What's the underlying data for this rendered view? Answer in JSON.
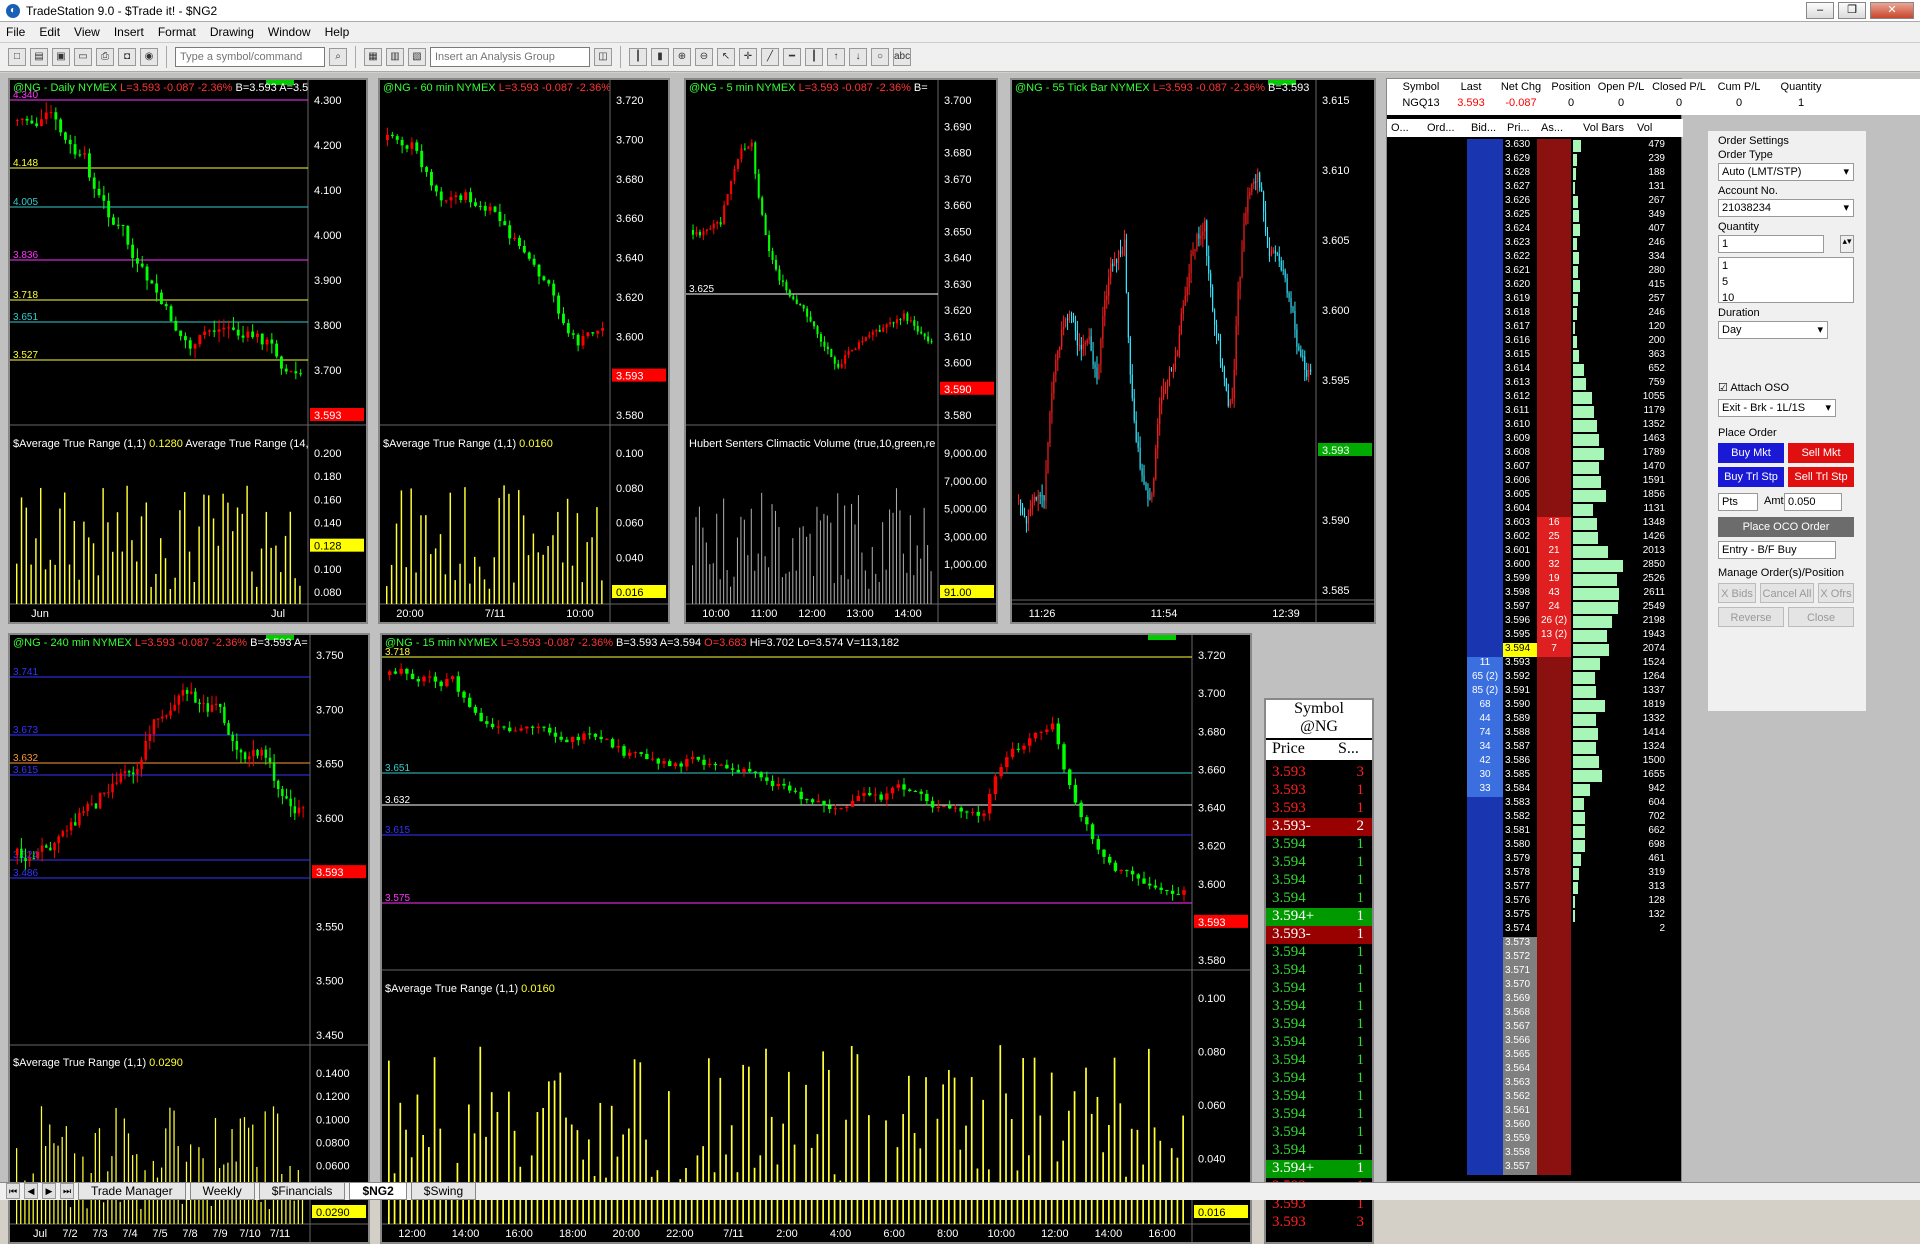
{
  "window": {
    "title": "TradeStation 9.0 - $Trade it! - $NG2"
  },
  "menu": [
    "File",
    "Edit",
    "View",
    "Insert",
    "Format",
    "Drawing",
    "Window",
    "Help"
  ],
  "toolbar": {
    "symbol_placeholder": "Type a symbol/command",
    "analysis_placeholder": "Insert an Analysis Group"
  },
  "charts": {
    "daily": {
      "symbol": "@NG - Daily",
      "exchange": "NYMEX",
      "last": "L=3.593",
      "chg": "-0.087",
      "pct": "-2.36%",
      "bid": "B=3.593",
      "ask": "A=3.5",
      "indicator": "$Average True Range (1,1)",
      "indicator_val": "0.1280",
      "indicator2": "Average True Range (14,",
      "y_ticks": [
        "4.300",
        "4.200",
        "4.100",
        "4.000",
        "3.900",
        "3.800",
        "3.700",
        "3.593"
      ],
      "ind_ticks": [
        "0.200",
        "0.180",
        "0.160",
        "0.140",
        "0.128",
        "0.100",
        "0.080"
      ],
      "levels": [
        "4.340",
        "4.148",
        "4.005",
        "3.836",
        "3.718",
        "3.651",
        "3.527"
      ],
      "x_ticks": [
        "Jun",
        "Jul"
      ]
    },
    "min60": {
      "symbol": "@NG - 60 min",
      "exchange": "NYMEX",
      "last": "L=3.593",
      "chg": "-0.087",
      "pct": "-2.36%",
      "indicator": "$Average True Range (1,1)",
      "indicator_val": "0.0160",
      "y_ticks": [
        "3.720",
        "3.700",
        "3.680",
        "3.660",
        "3.640",
        "3.620",
        "3.600",
        "3.593",
        "3.580"
      ],
      "ind_ticks": [
        "0.100",
        "0.080",
        "0.060",
        "0.040",
        "0.016"
      ],
      "x_ticks": [
        "20:00",
        "7/11",
        "10:00"
      ]
    },
    "min5": {
      "symbol": "@NG - 5 min",
      "exchange": "NYMEX",
      "last": "L=3.593",
      "chg": "-0.087",
      "pct": "-2.36%",
      "bid": "B=",
      "indicator": "Hubert Senters Climactic Volume (true,10,green,re",
      "level": "3.625",
      "y_ticks": [
        "3.700",
        "3.690",
        "3.680",
        "3.670",
        "3.660",
        "3.650",
        "3.640",
        "3.630",
        "3.620",
        "3.610",
        "3.600",
        "3.590",
        "3.580"
      ],
      "ind_ticks": [
        "9,000.00",
        "7,000.00",
        "5,000.00",
        "3,000.00",
        "1,000.00",
        "91.00"
      ],
      "x_ticks": [
        "10:00",
        "11:00",
        "12:00",
        "13:00",
        "14:00"
      ]
    },
    "tick55": {
      "symbol": "@NG - 55 Tick Bar",
      "exchange": "NYMEX",
      "last": "L=3.593",
      "chg": "-0.087",
      "pct": "-2.36%",
      "bid": "B=3.593",
      "y_ticks": [
        "3.615",
        "3.610",
        "3.605",
        "3.600",
        "3.595",
        "3.593",
        "3.590",
        "3.585"
      ],
      "x_ticks": [
        "11:26",
        "11:54",
        "12:39"
      ]
    },
    "min240": {
      "symbol": "@NG - 240 min",
      "exchange": "NYMEX",
      "last": "L=3.593",
      "chg": "-0.087",
      "pct": "-2.36%",
      "bid": "B=3.593",
      "ask": "A=",
      "indicator": "$Average True Range (1,1)",
      "indicator_val": "0.0290",
      "y_ticks": [
        "3.750",
        "3.700",
        "3.650",
        "3.600",
        "3.593",
        "3.550",
        "3.500",
        "3.450"
      ],
      "ind_ticks": [
        "0.1400",
        "0.1200",
        "0.1000",
        "0.0800",
        "0.0600",
        "0.0400",
        "0.0290"
      ],
      "levels": [
        "3.741",
        "3.673",
        "3.632",
        "3.615",
        "3.524",
        "3.486"
      ],
      "x_ticks": [
        "Jul",
        "7/2",
        "7/3",
        "7/4",
        "7/5",
        "7/8",
        "7/9",
        "7/10",
        "7/11"
      ]
    },
    "min15": {
      "symbol": "@NG - 15 min",
      "exchange": "NYMEX",
      "last": "L=3.593",
      "chg": "-0.087",
      "pct": "-2.36%",
      "bid": "B=3.593",
      "ask": "A=3.594",
      "open": "O=3.683",
      "hi": "Hi=3.702",
      "lo": "Lo=3.574",
      "vol": "V=113,182",
      "indicator": "$Average True Range (1,1)",
      "indicator_val": "0.0160",
      "levels": [
        "3.718",
        "3.651",
        "3.632",
        "3.615",
        "3.575"
      ],
      "y_ticks": [
        "3.720",
        "3.700",
        "3.680",
        "3.660",
        "3.640",
        "3.620",
        "3.600",
        "3.593",
        "3.580"
      ],
      "ind_ticks": [
        "0.100",
        "0.080",
        "0.060",
        "0.040",
        "0.016"
      ],
      "x_ticks": [
        "12:00",
        "14:00",
        "16:00",
        "18:00",
        "20:00",
        "22:00",
        "7/11",
        "2:00",
        "4:00",
        "6:00",
        "8:00",
        "10:00",
        "12:00",
        "14:00",
        "16:00"
      ]
    }
  },
  "time_sales": {
    "title": "Symbol",
    "symbol": "@NG",
    "col_price": "Price",
    "col_size": "S...",
    "rows": [
      {
        "p": "3.593",
        "s": "3",
        "c": "red"
      },
      {
        "p": "3.593",
        "s": "1",
        "c": "red"
      },
      {
        "p": "3.593",
        "s": "1",
        "c": "red"
      },
      {
        "p": "3.593-",
        "s": "2",
        "c": "redbox"
      },
      {
        "p": "3.594",
        "s": "1",
        "c": "green"
      },
      {
        "p": "3.594",
        "s": "1",
        "c": "green"
      },
      {
        "p": "3.594",
        "s": "1",
        "c": "green"
      },
      {
        "p": "3.594",
        "s": "1",
        "c": "green"
      },
      {
        "p": "3.594+",
        "s": "1",
        "c": "greenbox"
      },
      {
        "p": "3.593-",
        "s": "1",
        "c": "redbox"
      },
      {
        "p": "3.594",
        "s": "1",
        "c": "green"
      },
      {
        "p": "3.594",
        "s": "1",
        "c": "green"
      },
      {
        "p": "3.594",
        "s": "1",
        "c": "green"
      },
      {
        "p": "3.594",
        "s": "1",
        "c": "green"
      },
      {
        "p": "3.594",
        "s": "1",
        "c": "green"
      },
      {
        "p": "3.594",
        "s": "1",
        "c": "green"
      },
      {
        "p": "3.594",
        "s": "1",
        "c": "green"
      },
      {
        "p": "3.594",
        "s": "1",
        "c": "green"
      },
      {
        "p": "3.594",
        "s": "1",
        "c": "green"
      },
      {
        "p": "3.594",
        "s": "1",
        "c": "green"
      },
      {
        "p": "3.594",
        "s": "1",
        "c": "green"
      },
      {
        "p": "3.594",
        "s": "1",
        "c": "green"
      },
      {
        "p": "3.594+",
        "s": "1",
        "c": "greenbox"
      },
      {
        "p": "3.593",
        "s": "1",
        "c": "red"
      },
      {
        "p": "3.593",
        "s": "1",
        "c": "red"
      },
      {
        "p": "3.593",
        "s": "3",
        "c": "red"
      }
    ]
  },
  "matrix": {
    "top_headers": [
      "Symbol",
      "Last",
      "Net Chg",
      "Position",
      "Open P/L",
      "Closed P/L",
      "Cum P/L",
      "Quantity"
    ],
    "top_values": [
      "NGQ13",
      "3.593",
      "-0.087",
      "0",
      "0",
      "0",
      "0",
      "1"
    ],
    "col_headers": [
      "O...",
      "Ord...",
      "Bid...",
      "Pri...",
      "As...",
      "Vol Bars",
      "Vol"
    ],
    "rows": [
      {
        "price": "3.630",
        "vol": "479"
      },
      {
        "price": "3.629",
        "vol": "239"
      },
      {
        "price": "3.628",
        "vol": "188"
      },
      {
        "price": "3.627",
        "vol": "131"
      },
      {
        "price": "3.626",
        "vol": "267"
      },
      {
        "price": "3.625",
        "vol": "349"
      },
      {
        "price": "3.624",
        "vol": "407"
      },
      {
        "price": "3.623",
        "vol": "246"
      },
      {
        "price": "3.622",
        "vol": "334"
      },
      {
        "price": "3.621",
        "vol": "280"
      },
      {
        "price": "3.620",
        "vol": "415"
      },
      {
        "price": "3.619",
        "vol": "257"
      },
      {
        "price": "3.618",
        "vol": "246"
      },
      {
        "price": "3.617",
        "vol": "120"
      },
      {
        "price": "3.616",
        "vol": "200"
      },
      {
        "price": "3.615",
        "vol": "363"
      },
      {
        "price": "3.614",
        "vol": "652"
      },
      {
        "price": "3.613",
        "vol": "759"
      },
      {
        "price": "3.612",
        "vol": "1055"
      },
      {
        "price": "3.611",
        "vol": "1179"
      },
      {
        "price": "3.610",
        "vol": "1352"
      },
      {
        "price": "3.609",
        "vol": "1463"
      },
      {
        "price": "3.608",
        "vol": "1789"
      },
      {
        "price": "3.607",
        "vol": "1470"
      },
      {
        "price": "3.606",
        "vol": "1591"
      },
      {
        "price": "3.605",
        "vol": "1856"
      },
      {
        "price": "3.604",
        "vol": "1131"
      },
      {
        "price": "3.603",
        "ask": "16",
        "vol": "1348"
      },
      {
        "price": "3.602",
        "ask": "25",
        "vol": "1426"
      },
      {
        "price": "3.601",
        "ask": "21",
        "vol": "2013"
      },
      {
        "price": "3.600",
        "ask": "32",
        "vol": "2850"
      },
      {
        "price": "3.599",
        "ask": "19",
        "vol": "2526"
      },
      {
        "price": "3.598",
        "ask": "43",
        "vol": "2611"
      },
      {
        "price": "3.597",
        "ask": "24",
        "vol": "2549"
      },
      {
        "price": "3.596",
        "ask": "26 (2)",
        "vol": "2198"
      },
      {
        "price": "3.595",
        "ask": "13 (2)",
        "vol": "1943"
      },
      {
        "price": "3.594",
        "ask": "7",
        "vol": "2074"
      },
      {
        "price": "3.593",
        "bid": "11",
        "vol": "1524"
      },
      {
        "price": "3.592",
        "bid": "65 (2)",
        "vol": "1264"
      },
      {
        "price": "3.591",
        "bid": "85 (2)",
        "vol": "1337"
      },
      {
        "price": "3.590",
        "bid": "68",
        "vol": "1819"
      },
      {
        "price": "3.589",
        "bid": "44",
        "vol": "1332"
      },
      {
        "price": "3.588",
        "bid": "74",
        "vol": "1414"
      },
      {
        "price": "3.587",
        "bid": "34",
        "vol": "1324"
      },
      {
        "price": "3.586",
        "bid": "42",
        "vol": "1500"
      },
      {
        "price": "3.585",
        "bid": "30",
        "vol": "1655"
      },
      {
        "price": "3.584",
        "bid": "33",
        "vol": "942"
      },
      {
        "price": "3.583",
        "vol": "604"
      },
      {
        "price": "3.582",
        "vol": "702"
      },
      {
        "price": "3.581",
        "vol": "662"
      },
      {
        "price": "3.580",
        "vol": "698"
      },
      {
        "price": "3.579",
        "vol": "461"
      },
      {
        "price": "3.578",
        "vol": "319"
      },
      {
        "price": "3.577",
        "vol": "313"
      },
      {
        "price": "3.576",
        "vol": "128"
      },
      {
        "price": "3.575",
        "vol": "132"
      },
      {
        "price": "3.574",
        "vol": "2"
      },
      {
        "price": "3.573"
      },
      {
        "price": "3.572"
      },
      {
        "price": "3.571"
      },
      {
        "price": "3.570"
      },
      {
        "price": "3.569"
      },
      {
        "price": "3.568"
      },
      {
        "price": "3.567"
      },
      {
        "price": "3.566"
      },
      {
        "price": "3.565"
      },
      {
        "price": "3.564"
      },
      {
        "price": "3.563"
      },
      {
        "price": "3.562"
      },
      {
        "price": "3.561"
      },
      {
        "price": "3.560"
      },
      {
        "price": "3.559"
      },
      {
        "price": "3.558"
      },
      {
        "price": "3.557"
      }
    ]
  },
  "orders": {
    "title": "Order Settings",
    "order_type_label": "Order Type",
    "order_type": "Auto (LMT/STP)",
    "account_label": "Account No.",
    "account": "21038234",
    "quantity_label": "Quantity",
    "quantity": "1",
    "quantity_options": [
      "1",
      "5",
      "10"
    ],
    "duration_label": "Duration",
    "duration": "Day",
    "attach_oso": "Attach OSO",
    "exit_strategy": "Exit - Brk - 1L/1S",
    "place_order": "Place Order",
    "buy_mkt": "Buy Mkt",
    "sell_mkt": "Sell Mkt",
    "buy_trl": "Buy Trl Stp",
    "sell_trl": "Sell Trl Stp",
    "pts": "Pts",
    "amt_label": "Amt",
    "amt": "0.050",
    "place_oco": "Place OCO Order",
    "entry": "Entry - B/F Buy",
    "manage": "Manage Order(s)/Position",
    "x_bids": "X Bids",
    "cancel_all": "Cancel All",
    "x_ofrs": "X Ofrs",
    "reverse": "Reverse",
    "close": "Close"
  },
  "tabs": [
    "Trade Manager",
    "Weekly",
    "$Financials",
    "$NG2",
    "$Swing"
  ],
  "colors": {
    "bg": "#000000",
    "up": "#00ff00",
    "down": "#ff0000",
    "tick_up": "#33e6ff",
    "volume": "#ffff33"
  }
}
